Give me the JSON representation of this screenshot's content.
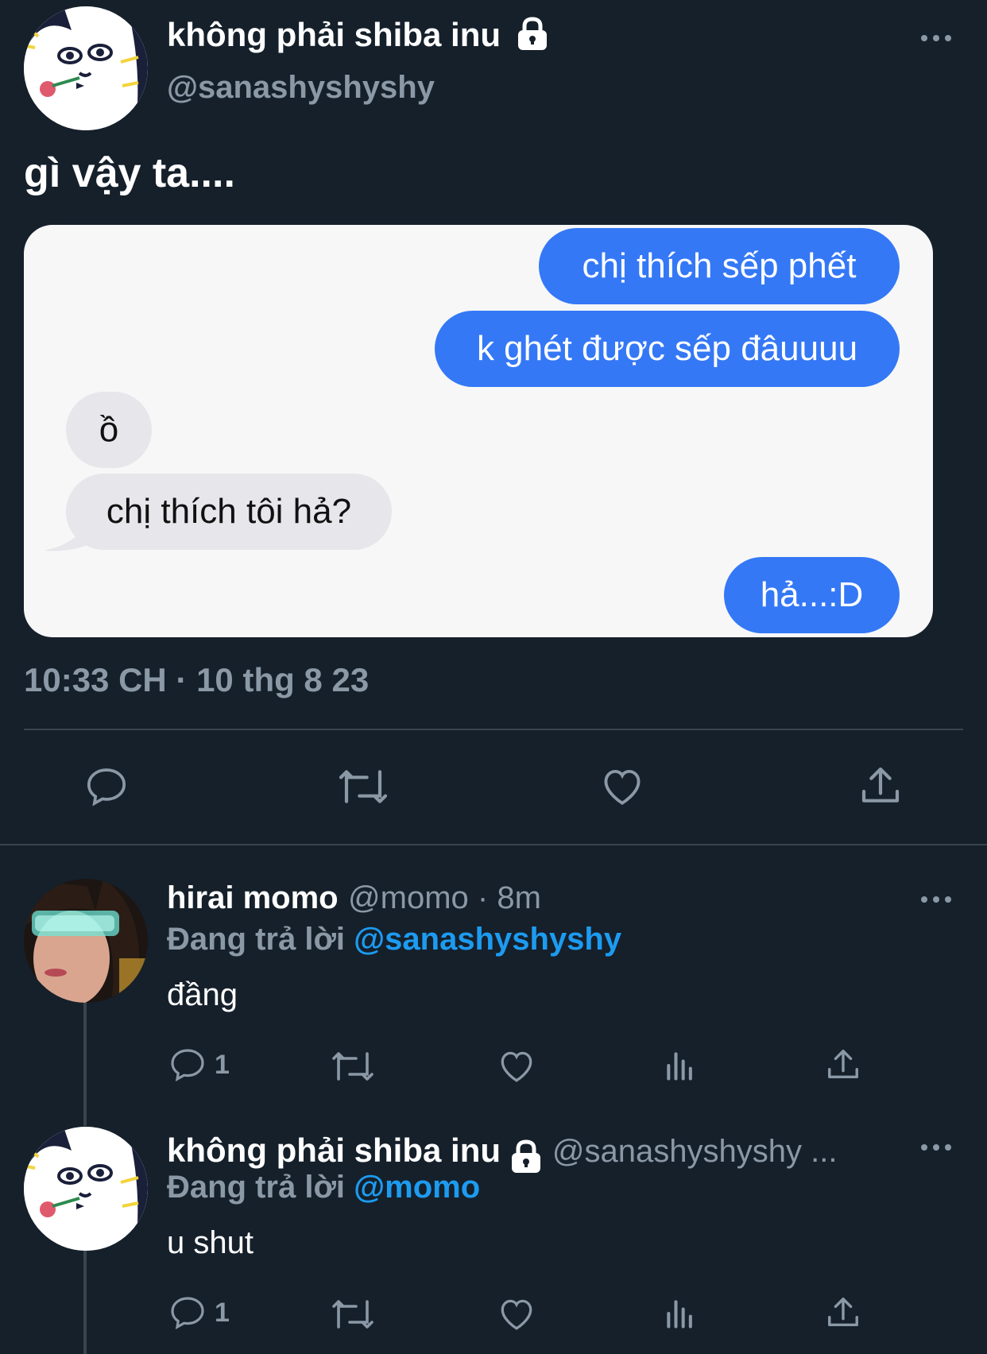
{
  "tweet": {
    "author": {
      "display_name": "không phải shiba inu",
      "handle": "@sanashyshyshy",
      "protected_icon": "lock-icon"
    },
    "more_icon": "more-horizontal-icon",
    "text": "gì vậy ta....",
    "screenshot_messages": {
      "out_1": "chị thích sếp phết",
      "out_2": "k ghét được sếp đâuuuu",
      "in_1": "ồ",
      "in_2": "chị thích tôi hả?",
      "out_3": "hả...:D"
    },
    "timestamp": "10:33 CH · 10 thg 8 23",
    "actions": [
      "reply-icon",
      "retweet-icon",
      "like-icon",
      "share-icon"
    ],
    "colors": {
      "bubble_out": "#3478f6",
      "bubble_in": "#e6e6eb",
      "background": "#15202b"
    }
  },
  "replies": [
    {
      "display_name": "hirai momo",
      "meta": "@momo · 8m",
      "replying_prefix": "Đang trả lời",
      "replying_to": "@sanashyshyshy",
      "text": "đầng",
      "reply_count": "1"
    },
    {
      "display_name": "không phải shiba inu",
      "meta": "@sanashyshyshy ...",
      "replying_prefix": "Đang trả lời",
      "replying_to": "@momo",
      "text": "u shut",
      "reply_count": "1"
    }
  ]
}
